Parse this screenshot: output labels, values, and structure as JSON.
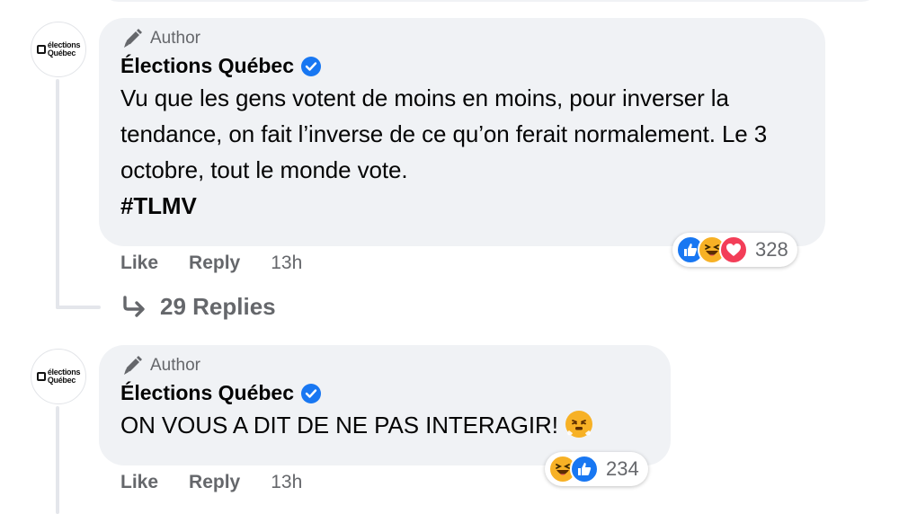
{
  "comments": [
    {
      "avatar_logo_text": [
        "élections",
        "Québec"
      ],
      "author_badge": "Author",
      "name": "Élections Québec",
      "verified": true,
      "text": "Vu que les gens votent de moins en moins, pour inverser la tendance, on fait l’inverse de ce qu’on ferait normalement. Le 3 octobre, tout le monde vote.",
      "hashtag": "#TLMV",
      "reactions": {
        "icons": [
          "like-icon",
          "haha-icon",
          "love-icon"
        ],
        "count": "328"
      },
      "actions": {
        "like": "Like",
        "reply": "Reply",
        "time": "13h"
      },
      "replies_label": "29 Replies"
    },
    {
      "avatar_logo_text": [
        "élections",
        "Québec"
      ],
      "author_badge": "Author",
      "name": "Élections Québec",
      "verified": true,
      "text": "ON VOUS A DIT DE NE PAS INTERAGIR!",
      "trailing_emoji": "face-with-steam-emoji",
      "reactions": {
        "icons": [
          "haha-icon",
          "like-icon"
        ],
        "count": "234"
      },
      "actions": {
        "like": "Like",
        "reply": "Reply",
        "time": "13h"
      }
    }
  ],
  "colors": {
    "bubble": "#f0f2f5",
    "secondary_text": "#65676b",
    "like_blue": "#1877f2",
    "haha_yellow": "#f7b125",
    "love_red": "#f33e58"
  }
}
